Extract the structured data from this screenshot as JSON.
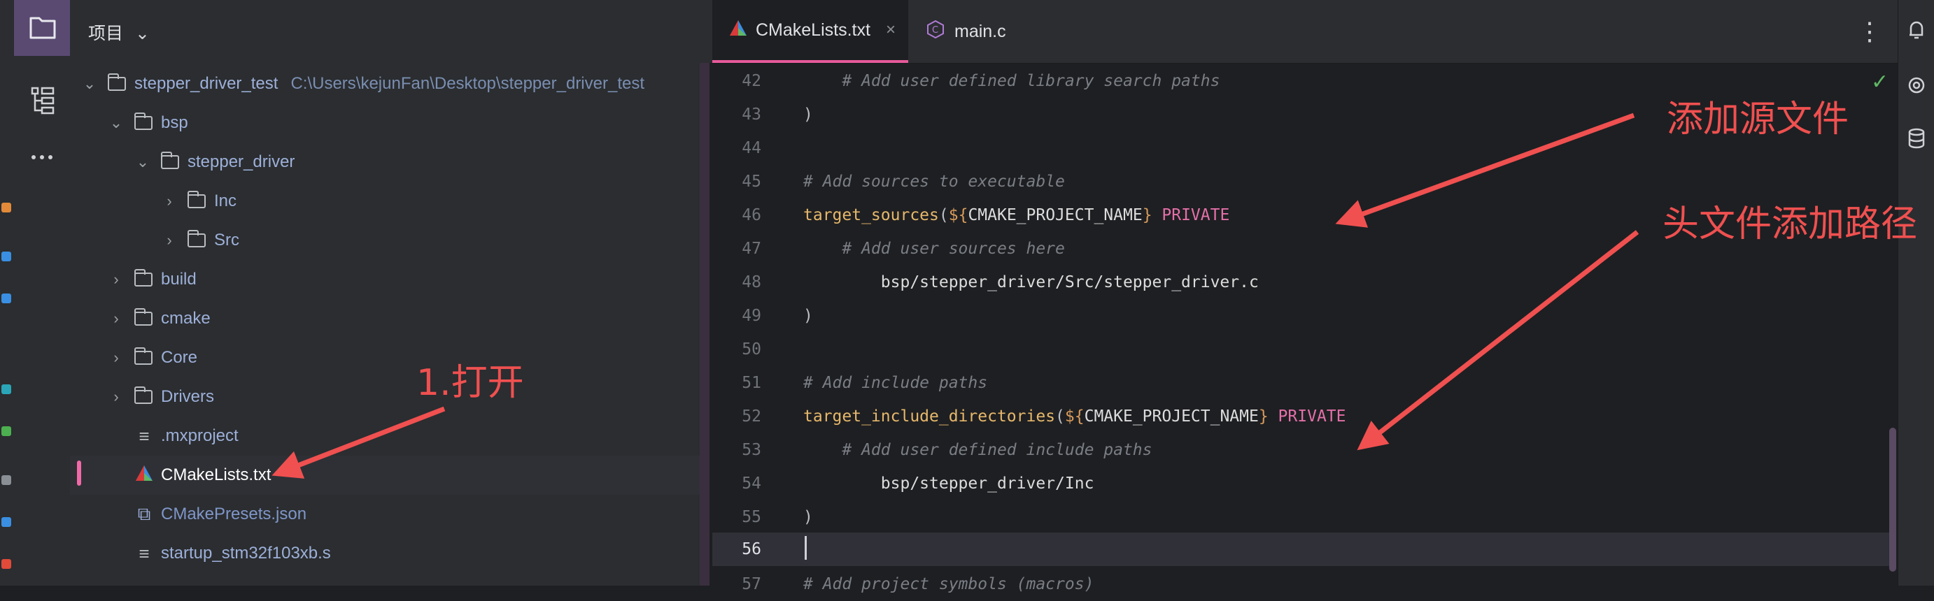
{
  "project_panel": {
    "header": "项目",
    "tree": [
      {
        "name": "stepper_driver_test",
        "path": "C:\\Users\\kejunFan\\Desktop\\stepper_driver_test"
      },
      {
        "name": "bsp"
      },
      {
        "name": "stepper_driver"
      },
      {
        "name": "Inc"
      },
      {
        "name": "Src"
      },
      {
        "name": "build"
      },
      {
        "name": "cmake"
      },
      {
        "name": "Core"
      },
      {
        "name": "Drivers"
      },
      {
        "name": ".mxproject"
      },
      {
        "name": "CMakeLists.txt"
      },
      {
        "name": "CMakePresets.json"
      },
      {
        "name": "startup_stm32f103xb.s"
      }
    ]
  },
  "editor": {
    "tabs": [
      {
        "label": "CMakeLists.txt",
        "close": "×"
      },
      {
        "label": "main.c"
      }
    ],
    "lines": [
      {
        "num": "42",
        "text": "    # Add user defined library search paths"
      },
      {
        "num": "43",
        "text": ")"
      },
      {
        "num": "44",
        "text": ""
      },
      {
        "num": "45",
        "text": "# Add sources to executable"
      },
      {
        "num": "46",
        "fn": "target_sources",
        "open": "(",
        "var_open": "${",
        "var": "CMAKE_PROJECT_NAME",
        "var_close": "}",
        "kw": " PRIVATE"
      },
      {
        "num": "47",
        "text": "    # Add user sources here"
      },
      {
        "num": "48",
        "text": "        bsp/stepper_driver/Src/stepper_driver.c"
      },
      {
        "num": "49",
        "text": ")"
      },
      {
        "num": "50",
        "text": ""
      },
      {
        "num": "51",
        "text": "# Add include paths"
      },
      {
        "num": "52",
        "fn": "target_include_directories",
        "open": "(",
        "var_open": "${",
        "var": "CMAKE_PROJECT_NAME",
        "var_close": "}",
        "kw": " PRIVATE"
      },
      {
        "num": "53",
        "text": "    # Add user defined include paths"
      },
      {
        "num": "54",
        "text": "        bsp/stepper_driver/Inc"
      },
      {
        "num": "55",
        "text": ")"
      },
      {
        "num": "56",
        "text": ""
      },
      {
        "num": "57",
        "text": "# Add project symbols (macros)"
      }
    ]
  },
  "annotations": {
    "open": "1.打开",
    "add_source": "添加源文件",
    "add_include": "头文件添加路径"
  },
  "colors": {
    "accent_tab": "#e75a9c",
    "annotation": "#f05050",
    "selection_marker": "#f16aa8"
  }
}
